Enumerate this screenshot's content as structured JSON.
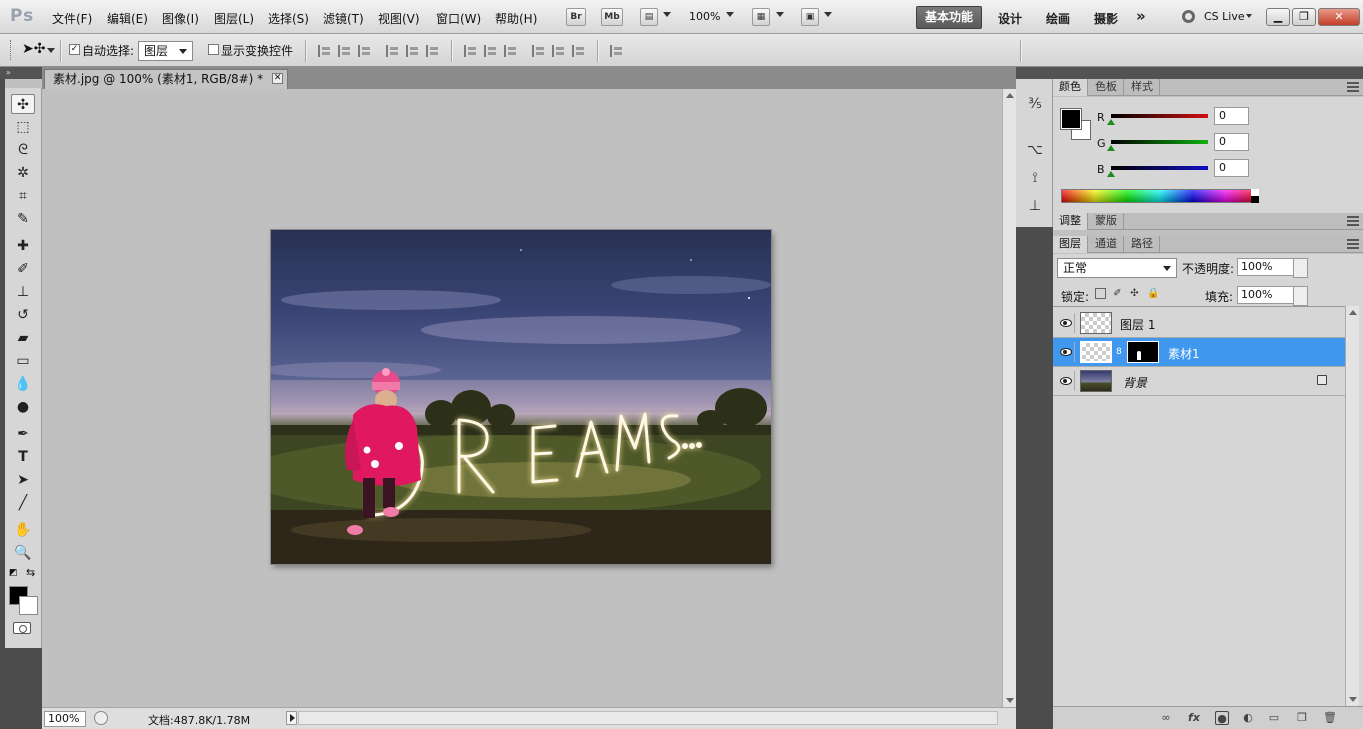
{
  "app": {
    "logo": "Ps"
  },
  "menu": [
    "文件(F)",
    "编辑(E)",
    "图像(I)",
    "图层(L)",
    "选择(S)",
    "滤镜(T)",
    "视图(V)",
    "窗口(W)",
    "帮助(H)"
  ],
  "toolbar_top": {
    "bridge_label": "Br",
    "minibridge_label": "Mb",
    "zoom": "100%",
    "workspaces": [
      "基本功能",
      "设计",
      "绘画",
      "摄影"
    ],
    "more": "»",
    "cslive": "CS Live"
  },
  "options": {
    "auto_select_label": "自动选择:",
    "auto_select_checked": true,
    "auto_select_target": "图层",
    "show_transform_label": "显示变换控件",
    "show_transform_checked": false
  },
  "tools": [
    "move-tool-icon",
    "marquee-tool-icon",
    "lasso-tool-icon",
    "quick-select-tool-icon",
    "crop-tool-icon",
    "eyedropper-tool-icon",
    "healing-brush-tool-icon",
    "brush-tool-icon",
    "clone-stamp-tool-icon",
    "history-brush-tool-icon",
    "eraser-tool-icon",
    "gradient-tool-icon",
    "blur-tool-icon",
    "dodge-tool-icon",
    "pen-tool-icon",
    "type-tool-icon",
    "path-select-tool-icon",
    "line-tool-icon",
    "hand-tool-icon",
    "zoom-tool-icon"
  ],
  "document": {
    "tab_title": "素材.jpg @ 100% (素材1, RGB/8#) *",
    "status_zoom": "100%",
    "doc_info": "文档:487.8K/1.78M"
  },
  "color_panel": {
    "tabs": [
      "颜色",
      "色板",
      "样式"
    ],
    "channels": [
      {
        "label": "R",
        "value": "0",
        "color": "#d01010"
      },
      {
        "label": "G",
        "value": "0",
        "color": "#10b010"
      },
      {
        "label": "B",
        "value": "0",
        "color": "#1010c8"
      }
    ]
  },
  "adjust_panel": {
    "tabs": [
      "调整",
      "蒙版"
    ]
  },
  "layers_panel": {
    "tabs": [
      "图层",
      "通道",
      "路径"
    ],
    "blend_mode": "正常",
    "opacity_label": "不透明度:",
    "opacity": "100%",
    "lock_label": "锁定:",
    "fill_label": "填充:",
    "fill": "100%",
    "layers": [
      {
        "name": "图层 1",
        "selected": false,
        "has_mask": false,
        "locked": false
      },
      {
        "name": "素材1",
        "selected": true,
        "has_mask": true,
        "locked": false
      },
      {
        "name": "背景",
        "selected": false,
        "has_mask": false,
        "locked": true
      }
    ]
  },
  "photo": {
    "text": "DREAMS..."
  }
}
